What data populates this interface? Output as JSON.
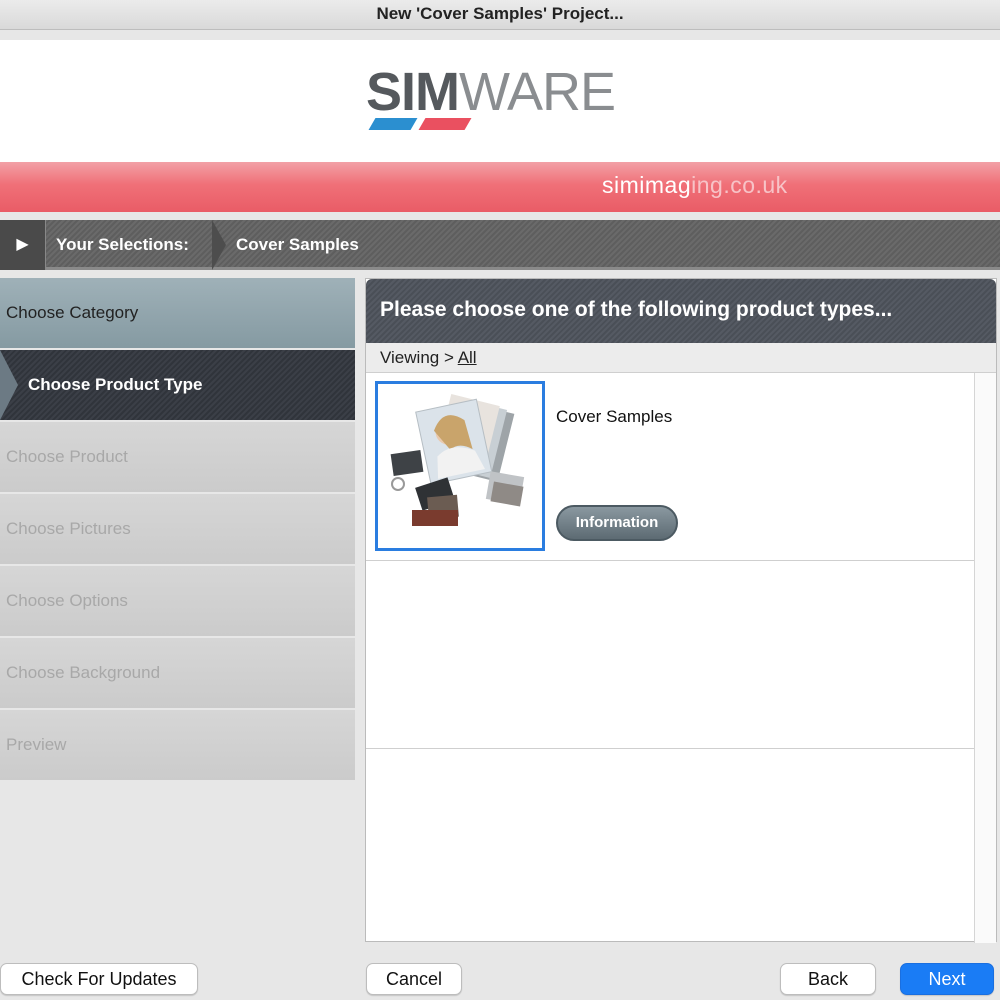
{
  "window": {
    "title": "New 'Cover Samples' Project..."
  },
  "brand": {
    "logo_bold": "SIM",
    "logo_light": "WARE",
    "url_main": "simimag",
    "url_faded": "ing.co.uk"
  },
  "selections": {
    "label": "Your Selections:",
    "value": "Cover Samples"
  },
  "steps": [
    {
      "label": "Choose Category",
      "state": "done"
    },
    {
      "label": "Choose Product Type",
      "state": "active"
    },
    {
      "label": "Choose Product",
      "state": "pending"
    },
    {
      "label": "Choose Pictures",
      "state": "pending"
    },
    {
      "label": "Choose Options",
      "state": "pending"
    },
    {
      "label": "Choose Background",
      "state": "pending"
    },
    {
      "label": "Preview",
      "state": "pending"
    }
  ],
  "panel": {
    "heading": "Please choose one of the following product types...",
    "viewing_prefix": "Viewing >",
    "viewing_link": "All"
  },
  "products": [
    {
      "name": "Cover Samples",
      "info_label": "Information",
      "selected": true
    }
  ],
  "buttons": {
    "check_updates": "Check For Updates",
    "cancel": "Cancel",
    "back": "Back",
    "next": "Next"
  },
  "colors": {
    "accent_blue": "#1a7cf5",
    "brand_red": "#ea5060",
    "brand_blue": "#2b8fd0",
    "selection_border": "#2a7de0"
  }
}
